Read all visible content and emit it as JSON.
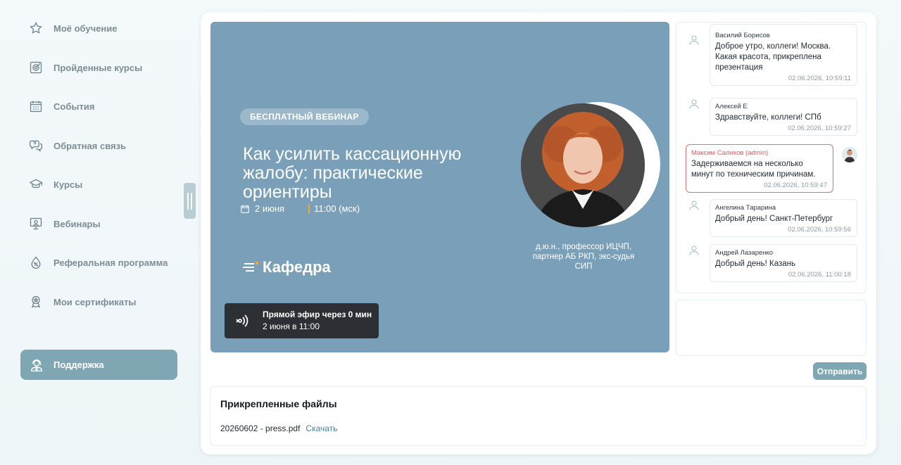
{
  "sidebar": {
    "items": [
      {
        "label": "Моё обучение",
        "icon": "star-icon"
      },
      {
        "label": "Пройденные курсы",
        "icon": "target-icon"
      },
      {
        "label": "События",
        "icon": "calendar-icon"
      },
      {
        "label": "Обратная связь",
        "icon": "feedback-icon"
      },
      {
        "label": "Курсы",
        "icon": "graduation-cap-icon"
      },
      {
        "label": "Вебинары",
        "icon": "monitor-icon"
      },
      {
        "label": "Реферальная программа",
        "icon": "percent-drop-icon"
      },
      {
        "label": "Мои сертификаты",
        "icon": "award-icon"
      }
    ],
    "support": {
      "label": "Поддержка",
      "icon": "support-agent-icon"
    }
  },
  "banner": {
    "badge": "БЕСПЛАТНЫЙ ВЕБИНАР",
    "title": "Как усилить кассационную жалобу: практические ориентиры",
    "date": "2 июня",
    "time": "11:00 (мск)",
    "brand": "Кафедра",
    "speaker": "д.ю.н., профессор ИЦЧП, партнер АБ РКП, экс-судья СИП",
    "live": {
      "title": "Прямой эфир через 0 мин",
      "subtitle": "2 июня в 11:00"
    }
  },
  "chat": {
    "messages": [
      {
        "author": "Василий Борисов",
        "text": "Доброе утро, коллеги! Москва. Какая красота, прикреплена презентация",
        "time": "02.06.2026, 10:59:11",
        "admin": false
      },
      {
        "author": "Алексей Е",
        "text": "Здравствуйте, коллеги! СПб",
        "time": "02.06.2026, 10:59:27",
        "admin": false
      },
      {
        "author": "Максим Саликов (admin)",
        "text": "Задерживаемся на несколько минут по техническим причинам.",
        "time": "02.06.2026, 10:59:47",
        "admin": true
      },
      {
        "author": "Ангелина Тарарина",
        "text": "Добрый день! Санкт-Петербург",
        "time": "02.06.2026, 10:59:56",
        "admin": false
      },
      {
        "author": "Андрей Лазаренко",
        "text": "Добрый день! Казань",
        "time": "02.06.2026, 11:00:18",
        "admin": false
      }
    ],
    "input_value": "",
    "send_label": "Отправить"
  },
  "files": {
    "title": "Прикрепленные файлы",
    "items": [
      {
        "name": "20260602 - press.pdf",
        "action": "Скачать"
      }
    ]
  },
  "colors": {
    "accent": "#7fa6b3",
    "banner_bg": "#7aa0b9",
    "admin": "#e05a5a",
    "live_bg": "#2c2f33"
  }
}
